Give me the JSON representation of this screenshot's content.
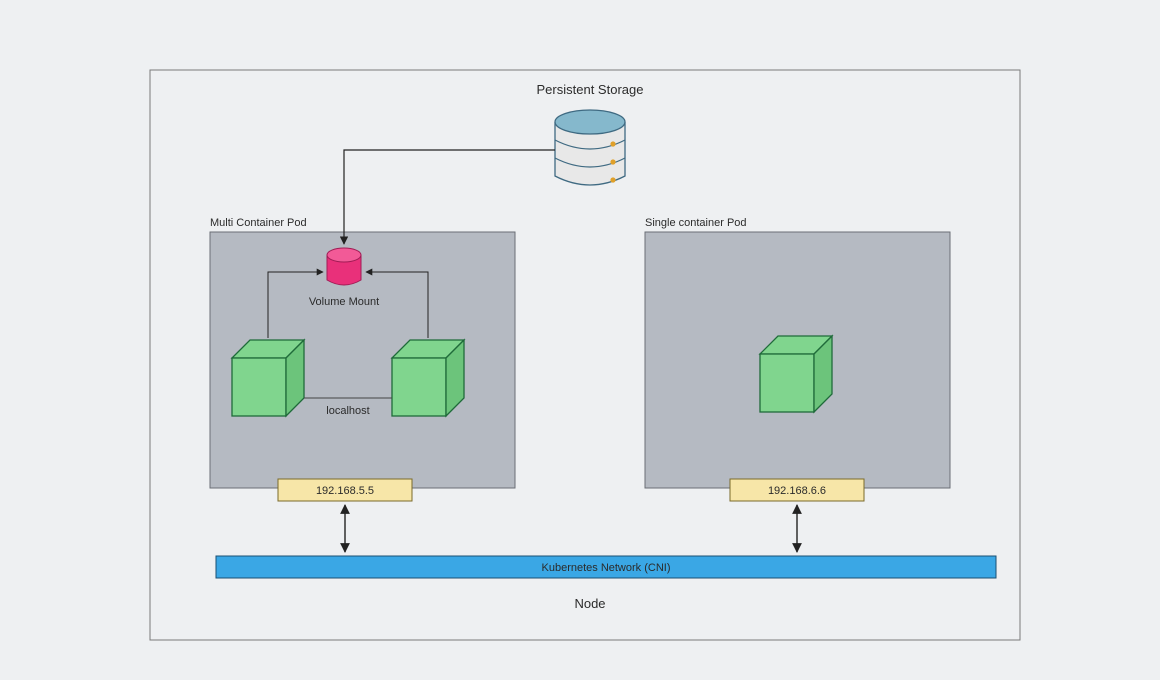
{
  "labels": {
    "persistent_storage": "Persistent Storage",
    "multi_pod": "Multi Container Pod",
    "single_pod": "Single container Pod",
    "volume_mount": "Volume Mount",
    "localhost": "localhost",
    "network": "Kubernetes Network (CNI)",
    "node": "Node",
    "ip_multi": "192.168.5.5",
    "ip_single": "192.168.6.6"
  },
  "colors": {
    "bg": "#eef0f2",
    "node_stroke": "#7a7a7a",
    "pod_fill": "#b5bac2",
    "pod_stroke": "#6a6e75",
    "cube_fill": "#80d58e",
    "cube_stroke": "#1f6b3a",
    "vol_fill": "#e9307a",
    "vol_top": "#f25a97",
    "storage_fill": "#e8e8e8",
    "storage_top": "#85b8cc",
    "storage_stroke": "#3f6a82",
    "storage_dot": "#e0a029",
    "ip_fill": "#f7e6a8",
    "ip_stroke": "#7a6a2a",
    "net_fill": "#3aa7e5",
    "net_stroke": "#1b4f72",
    "arrow": "#222"
  }
}
